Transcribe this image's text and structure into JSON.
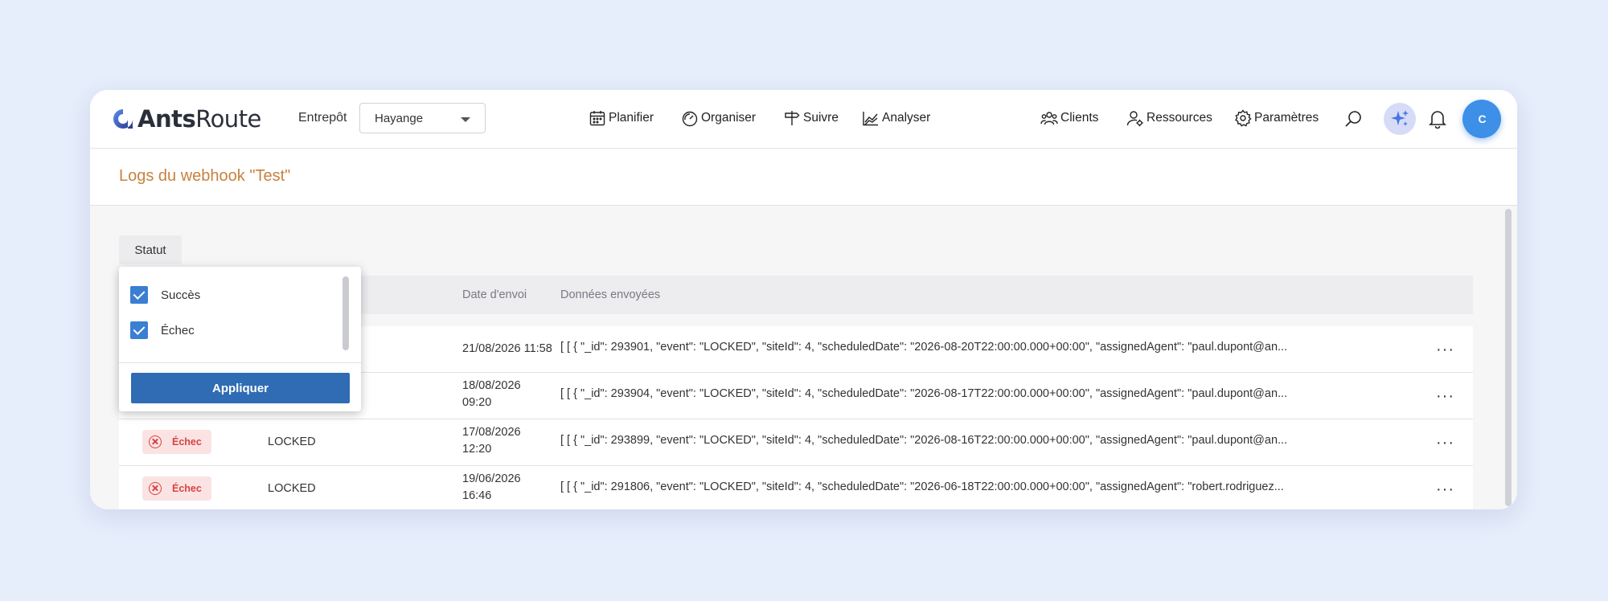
{
  "brand": {
    "name_bold": "Ants",
    "name_regular": "Route"
  },
  "header": {
    "warehouse_label": "Entrepôt",
    "warehouse_value": "Hayange",
    "nav": [
      {
        "label": "Planifier",
        "icon": "calendar-icon"
      },
      {
        "label": "Organiser",
        "icon": "gauge-icon"
      },
      {
        "label": "Suivre",
        "icon": "signpost-icon"
      },
      {
        "label": "Analyser",
        "icon": "chart-icon"
      }
    ],
    "right_nav": [
      {
        "label": "Clients",
        "icon": "users-icon"
      },
      {
        "label": "Ressources",
        "icon": "user-gear-icon"
      },
      {
        "label": "Paramètres",
        "icon": "gear-icon"
      }
    ],
    "avatar_initials": "C",
    "accent": "#3d8fe8"
  },
  "page": {
    "title": "Logs du webhook \"Test\""
  },
  "filter": {
    "chip_label": "Statut"
  },
  "dropdown": {
    "options": [
      {
        "label": "Succès",
        "checked": true
      },
      {
        "label": "Échec",
        "checked": true
      }
    ],
    "apply_label": "Appliquer"
  },
  "table": {
    "headers": {
      "date": "Date d'envoi",
      "data": "Données envoyées"
    },
    "rows": [
      {
        "status": "",
        "event": "",
        "date": "21/08/2026 11:58",
        "data": "[ [ { \"_id\": 293901, \"event\": \"LOCKED\", \"siteId\": 4, \"scheduledDate\": \"2026-08-20T22:00:00.000+00:00\", \"assignedAgent\": \"paul.dupont@an..."
      },
      {
        "status": "",
        "event": "",
        "date": "18/08/2026\n09:20",
        "data": "[ [ { \"_id\": 293904, \"event\": \"LOCKED\", \"siteId\": 4, \"scheduledDate\": \"2026-08-17T22:00:00.000+00:00\", \"assignedAgent\": \"paul.dupont@an..."
      },
      {
        "status": "Échec",
        "event": "LOCKED",
        "date": "17/08/2026\n12:20",
        "data": "[ [ { \"_id\": 293899, \"event\": \"LOCKED\", \"siteId\": 4, \"scheduledDate\": \"2026-08-16T22:00:00.000+00:00\", \"assignedAgent\": \"paul.dupont@an..."
      },
      {
        "status": "Échec",
        "event": "LOCKED",
        "date": "19/06/2026\n16:46",
        "data": "[ [ { \"_id\": 291806, \"event\": \"LOCKED\", \"siteId\": 4, \"scheduledDate\": \"2026-06-18T22:00:00.000+00:00\", \"assignedAgent\": \"robert.rodriguez..."
      }
    ],
    "more_label": "···"
  }
}
